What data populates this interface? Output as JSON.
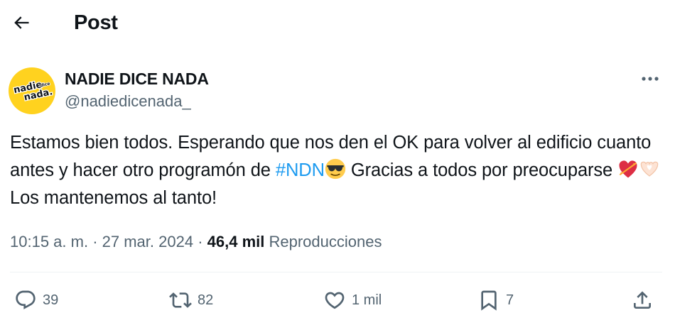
{
  "header": {
    "back_icon": "arrow-left-icon",
    "title": "Post"
  },
  "author": {
    "avatar_text_top": "nadie",
    "avatar_text_mid": "dice",
    "avatar_text_bottom": "nada.",
    "avatar_color": "#ffd21f",
    "name": "NADIE DICE NADA",
    "handle": "@nadiedicenada_"
  },
  "tweet": {
    "text_part1": "Estamos bien todos. Esperando que nos den el OK para volver al edificio cuanto antes y hacer otro programón de ",
    "hashtag": "#NDN",
    "text_part2": " Gracias a todos por preocuparse ",
    "text_part3": " Los mantenemos al tanto!",
    "hashtag_color": "#1d9bf0"
  },
  "meta": {
    "time": "10:15 a. m.",
    "separator1": " · ",
    "date": "27 mar. 2024",
    "separator2": " · ",
    "views_count": "46,4 mil",
    "views_label": "Reproducciones"
  },
  "actions": {
    "replies": "39",
    "reposts": "82",
    "likes": "1 mil",
    "bookmarks": "7"
  },
  "colors": {
    "text": "#0f1419",
    "secondary": "#536471",
    "divider": "#eff3f4"
  }
}
